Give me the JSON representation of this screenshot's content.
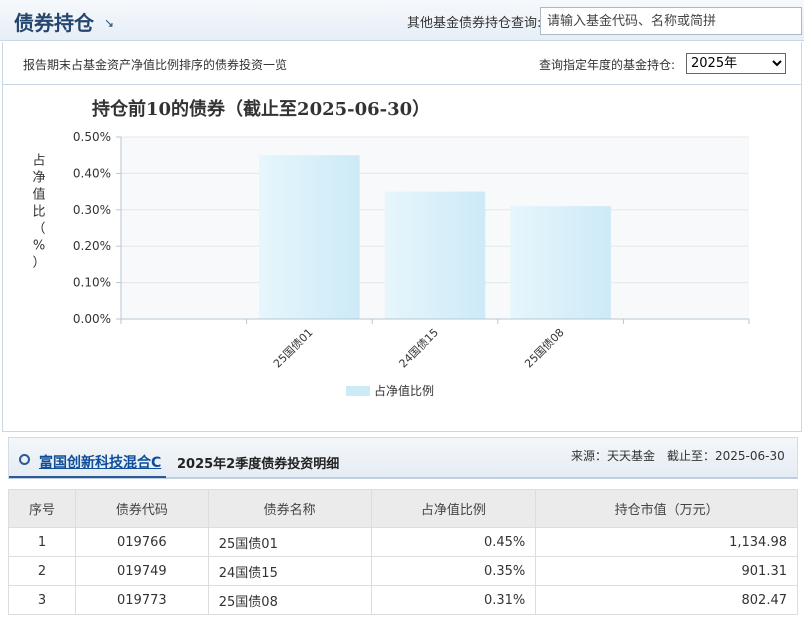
{
  "header": {
    "title": "债券持仓",
    "arrow": "↘",
    "search_label": "其他基金债券持仓查询:",
    "search_placeholder": "请输入基金代码、名称或简拼"
  },
  "subbar": {
    "description": "报告期末占基金资产净值比例排序的债券投资一览",
    "year_label": "查询指定年度的基金持仓:",
    "year_selected": "2025年"
  },
  "chart_data": {
    "type": "bar",
    "title": "持仓前10的债券（截止至2025-06-30）",
    "ylabel": "占净值比（%）",
    "categories": [
      "",
      "25国债01",
      "24国债15",
      "25国债08",
      ""
    ],
    "series": [
      {
        "name": "占净值比例",
        "values": [
          null,
          0.45,
          0.35,
          0.31,
          null
        ]
      }
    ],
    "ylim": [
      0,
      0.5
    ],
    "yticks": [
      "0.00%",
      "0.10%",
      "0.20%",
      "0.30%",
      "0.40%",
      "0.50%"
    ],
    "legend": "bottom-center",
    "grid": true,
    "bar_color": "#cdeaf7"
  },
  "details": {
    "fund_name": "富国创新科技混合C",
    "title": "2025年2季度债券投资明细",
    "source": "来源：天天基金　截止至：2025-06-30",
    "columns": [
      "序号",
      "债券代码",
      "债券名称",
      "占净值比例",
      "持仓市值（万元）"
    ],
    "rows": [
      [
        "1",
        "019766",
        "25国债01",
        "0.45%",
        "1,134.98"
      ],
      [
        "2",
        "019749",
        "24国债15",
        "0.35%",
        "901.31"
      ],
      [
        "3",
        "019773",
        "25国债08",
        "0.31%",
        "802.47"
      ]
    ]
  }
}
